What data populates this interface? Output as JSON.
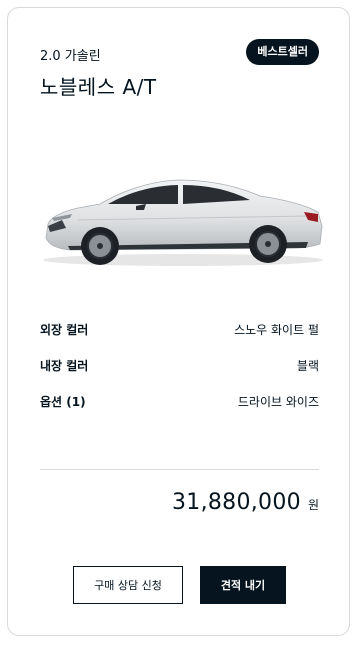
{
  "card": {
    "trim": "2.0 가솔린",
    "model": "노블레스 A/T",
    "badge": "베스트셀러"
  },
  "specs": [
    {
      "label": "외장 컬러",
      "value": "스노우 화이트 펄"
    },
    {
      "label": "내장 컬러",
      "value": "블랙"
    },
    {
      "label": "옵션 (1)",
      "value": "드라이브 와이즈"
    }
  ],
  "price": {
    "amount": "31,880,000",
    "unit": "원"
  },
  "buttons": {
    "consult": "구매 상담 신청",
    "quote": "견적 내기"
  },
  "colors": {
    "brand_dark": "#05141f",
    "border": "#d9d9d9",
    "car_body": "#e4e6e8"
  }
}
